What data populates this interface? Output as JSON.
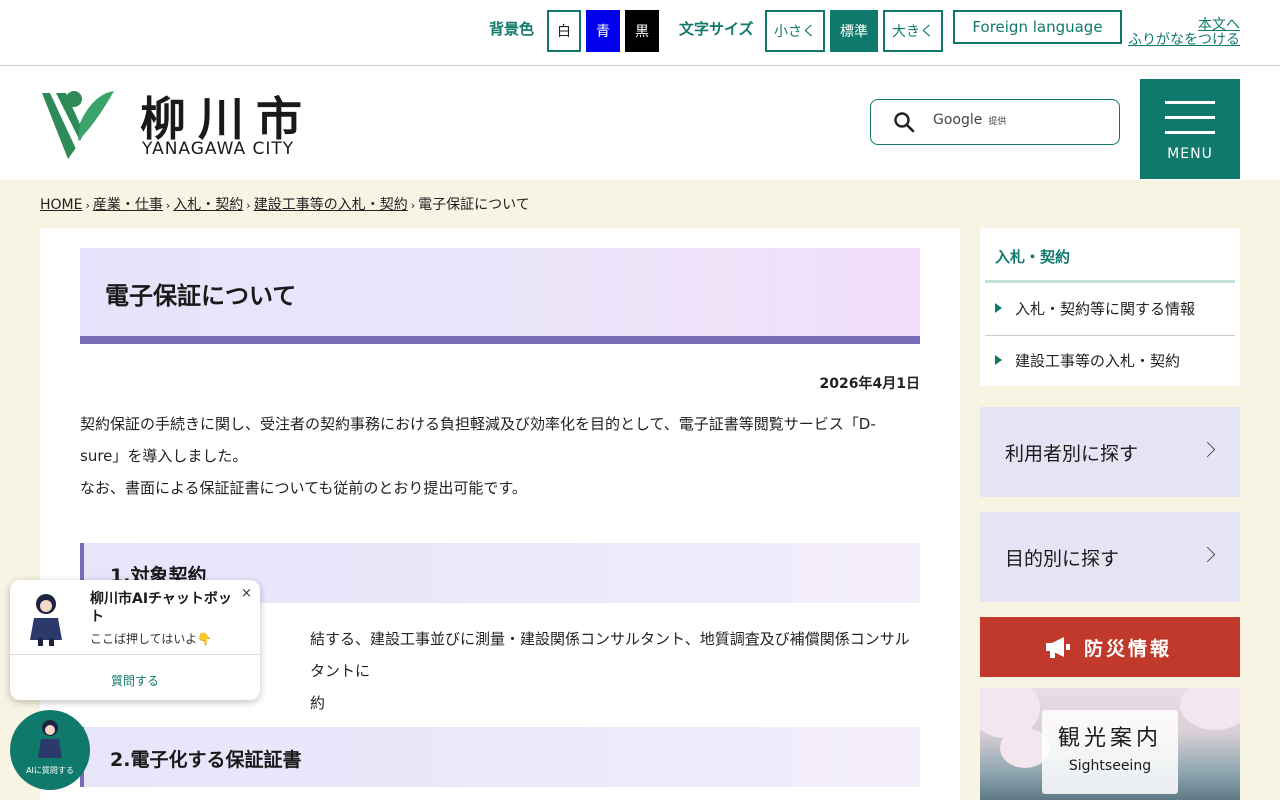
{
  "topbar": {
    "bg_label": "背景色",
    "bg_white": "白",
    "bg_blue": "青",
    "bg_black": "黒",
    "font_label": "文字サイズ",
    "font_small": "小さく",
    "font_standard": "標準",
    "font_large": "大きく",
    "foreign": "Foreign language",
    "skip_link": "本文へ",
    "furigana_link": "ふりがなをつける"
  },
  "header": {
    "logo_kanji": "柳川市",
    "logo_en": "YANAGAWA CITY",
    "search_placeholder": "Google",
    "search_sub": "提供",
    "menu_label": "MENU"
  },
  "breadcrumb": [
    "HOME",
    "産業・仕事",
    "入札・契約",
    "建設工事等の入札・契約",
    "電子保証について"
  ],
  "breadcrumb_sep": "›",
  "main": {
    "title": "電子保証について",
    "date": "2026年4月1日",
    "intro_line1": "契約保証の手続きに関し、受注者の契約事務における負担軽減及び効率化を目的として、電子証書等閲覧サービス「D-",
    "intro_line2": "sure」を導入しました。",
    "intro_line3": "なお、書面による保証証書についても従前のとおり提出可能です。",
    "section1_title": "1.対象契約",
    "section1_line1": "結する、建設工事並びに測量・建設関係コンサルタント、地質調査及び補償関係コンサルタントに",
    "section1_line2": "約",
    "section2_title": "2.電子化する保証証書"
  },
  "sidebar": {
    "menu_title": "入札・契約",
    "items": [
      "入札・契約等に関する情報",
      "建設工事等の入札・契約"
    ],
    "find_by_user": "利用者別に探す",
    "find_by_purpose": "目的別に探す",
    "disaster": "防災情報",
    "tourism_jp": "観光案内",
    "tourism_en": "Sightseeing"
  },
  "chat": {
    "title": "柳川市AIチャットボット",
    "subtitle": "ここば押してはいよ👇",
    "close": "×",
    "ask": "質問する",
    "circle_label": "AIに質問する"
  },
  "colors": {
    "brand_teal": "#0f7a6b",
    "cream": "#f7f4e3",
    "title_accent": "#7a6db8",
    "disaster_red": "#c0392b"
  }
}
